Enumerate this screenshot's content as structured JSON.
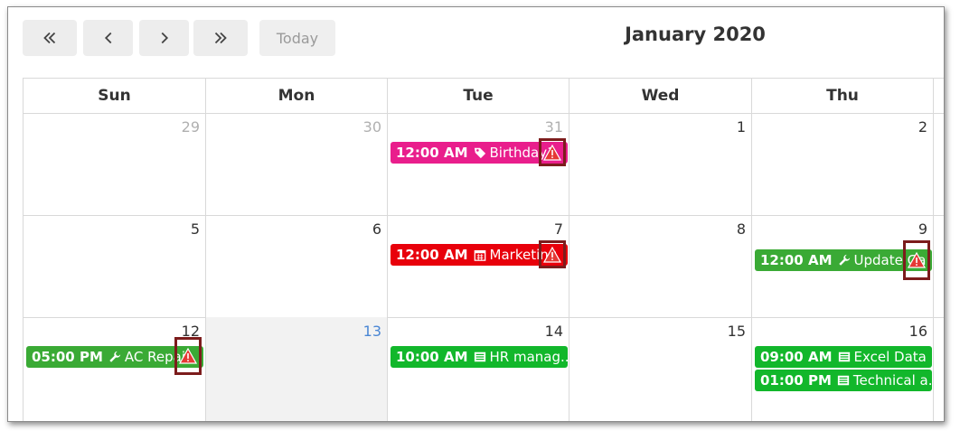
{
  "toolbar": {
    "prev_year_label": "«",
    "prev_label": "‹",
    "next_label": "›",
    "next_year_label": "»",
    "today_label": "Today",
    "title": "January 2020"
  },
  "weekdays": [
    "Sun",
    "Mon",
    "Tue",
    "Wed",
    "Thu"
  ],
  "weeks": [
    {
      "days": [
        "29",
        "30",
        "31",
        "1",
        "2"
      ]
    },
    {
      "days": [
        "5",
        "6",
        "7",
        "8",
        "9"
      ]
    },
    {
      "days": [
        "12",
        "13",
        "14",
        "15",
        "16"
      ]
    }
  ],
  "events": {
    "birthday": {
      "time": "12:00 AM",
      "title": "Birthday1",
      "color": "#e91e8c",
      "icon": "tag-icon"
    },
    "marketing": {
      "time": "12:00 AM",
      "title": "Marketing",
      "color": "#e8000b",
      "icon": "calendar-icon"
    },
    "update": {
      "time": "12:00 AM",
      "title": "Update Ga",
      "color": "#3aaa35",
      "icon": "wrench-icon"
    },
    "ac_repair": {
      "time": "05:00 PM",
      "title": "AC Repair",
      "color": "#3aaa35",
      "icon": "wrench-icon"
    },
    "hr": {
      "time": "10:00 AM",
      "title": "HR manag...",
      "color": "#12b72b",
      "icon": "list-icon"
    },
    "excel": {
      "time": "09:00 AM",
      "title": "Excel Data ...",
      "color": "#12b72b",
      "icon": "list-icon"
    },
    "technical": {
      "time": "01:00 PM",
      "title": "Technical a...",
      "color": "#12b72b",
      "icon": "list-icon"
    }
  },
  "colors": {
    "warning_red": "#e53935",
    "highlight_border": "#7c1c1c",
    "today_number": "#4a86d4"
  }
}
